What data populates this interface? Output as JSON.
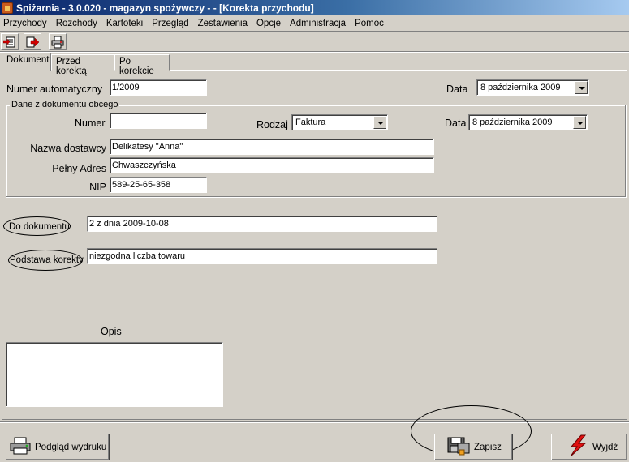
{
  "window": {
    "title": "Spiżarnia - 3.0.020 - magazyn spożywczy -  - [Korekta przychodu]"
  },
  "menu": [
    "Przychody",
    "Rozchody",
    "Kartoteki",
    "Przegląd",
    "Zestawienia",
    "Opcje",
    "Administracja",
    "Pomoc"
  ],
  "toolbar": {
    "icons": [
      "new-document-icon",
      "export-icon",
      "print-icon"
    ]
  },
  "tabs": [
    "Dokument",
    "Przed korektą",
    "Po korekcie"
  ],
  "form": {
    "numer_auto_label": "Numer automatyczny",
    "numer_auto_value": "1/2009",
    "data_label": "Data",
    "data_value": "8 października 2009",
    "group_title": "Dane z dokumentu obcego",
    "numer_label": "Numer",
    "numer_value": "",
    "rodzaj_label": "Rodzaj",
    "rodzaj_value": "Faktura",
    "data2_label": "Data",
    "data2_value": "8 października 2009",
    "nazwa_label": "Nazwa dostawcy",
    "nazwa_value": "Delikatesy \"Anna\"",
    "adres_label": "Pełny Adres",
    "adres_value": "Chwaszczyńska",
    "nip_label": "NIP",
    "nip_value": "589-25-65-358",
    "do_dokumentu_label": "Do dokumentu",
    "do_dokumentu_value": "2 z dnia 2009-10-08",
    "podstawa_label": "Podstawa korekty",
    "podstawa_value": "niezgodna liczba towaru",
    "opis_label": "Opis",
    "opis_value": ""
  },
  "buttons": {
    "preview": "Podgląd wydruku",
    "save": "Zapisz",
    "exit": "Wyjdź"
  }
}
